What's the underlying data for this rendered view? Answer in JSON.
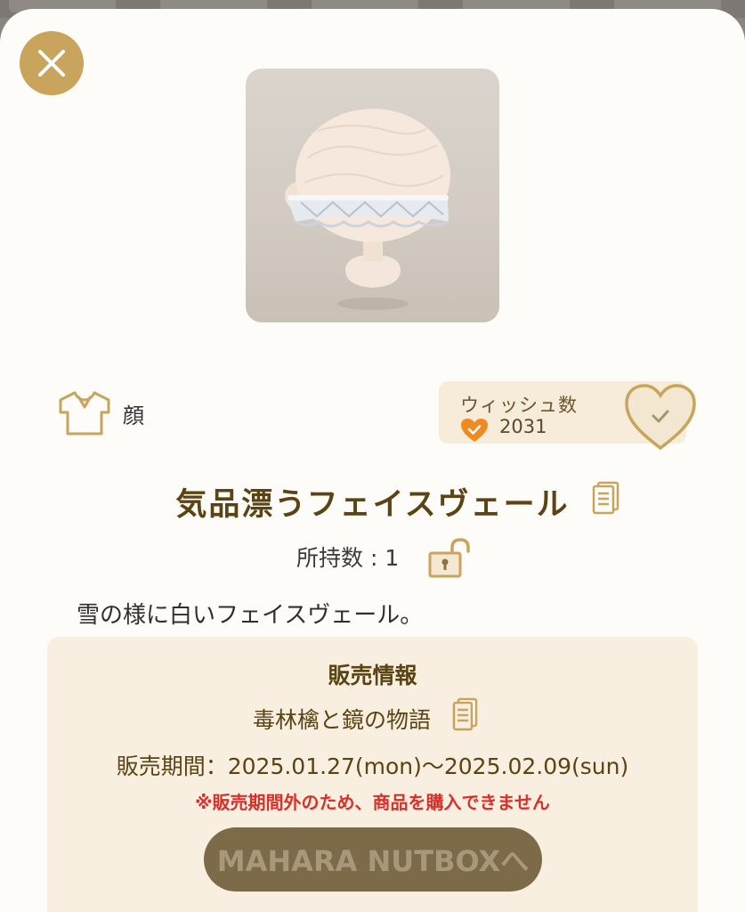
{
  "item": {
    "image_alt": "face veil item",
    "category": "顔",
    "name": "気品漂うフェイスヴェール",
    "owned": "所持数 : 1",
    "description": "雪の様に白いフェイスヴェール。"
  },
  "wishlist": {
    "label": "ウィッシュ数",
    "count": "2031"
  },
  "sale": {
    "heading": "販売情報",
    "story": "毒林檎と鏡の物語",
    "period": "販売期間：2025.01.27(mon)〜2025.02.09(sun)",
    "warning": "※販売期間外のため、商品を購入できません",
    "button_label": "MAHARA NUTBOXへ"
  },
  "colors": {
    "accent_gold": "#c8a45d",
    "title_brown": "#5b4413",
    "warning_red": "#d8302b",
    "panel_beige": "#f8efe0"
  },
  "icons": [
    "close-icon",
    "shirt-icon",
    "heart-icon",
    "heart-check-icon",
    "document-icon",
    "lock-open-icon"
  ]
}
